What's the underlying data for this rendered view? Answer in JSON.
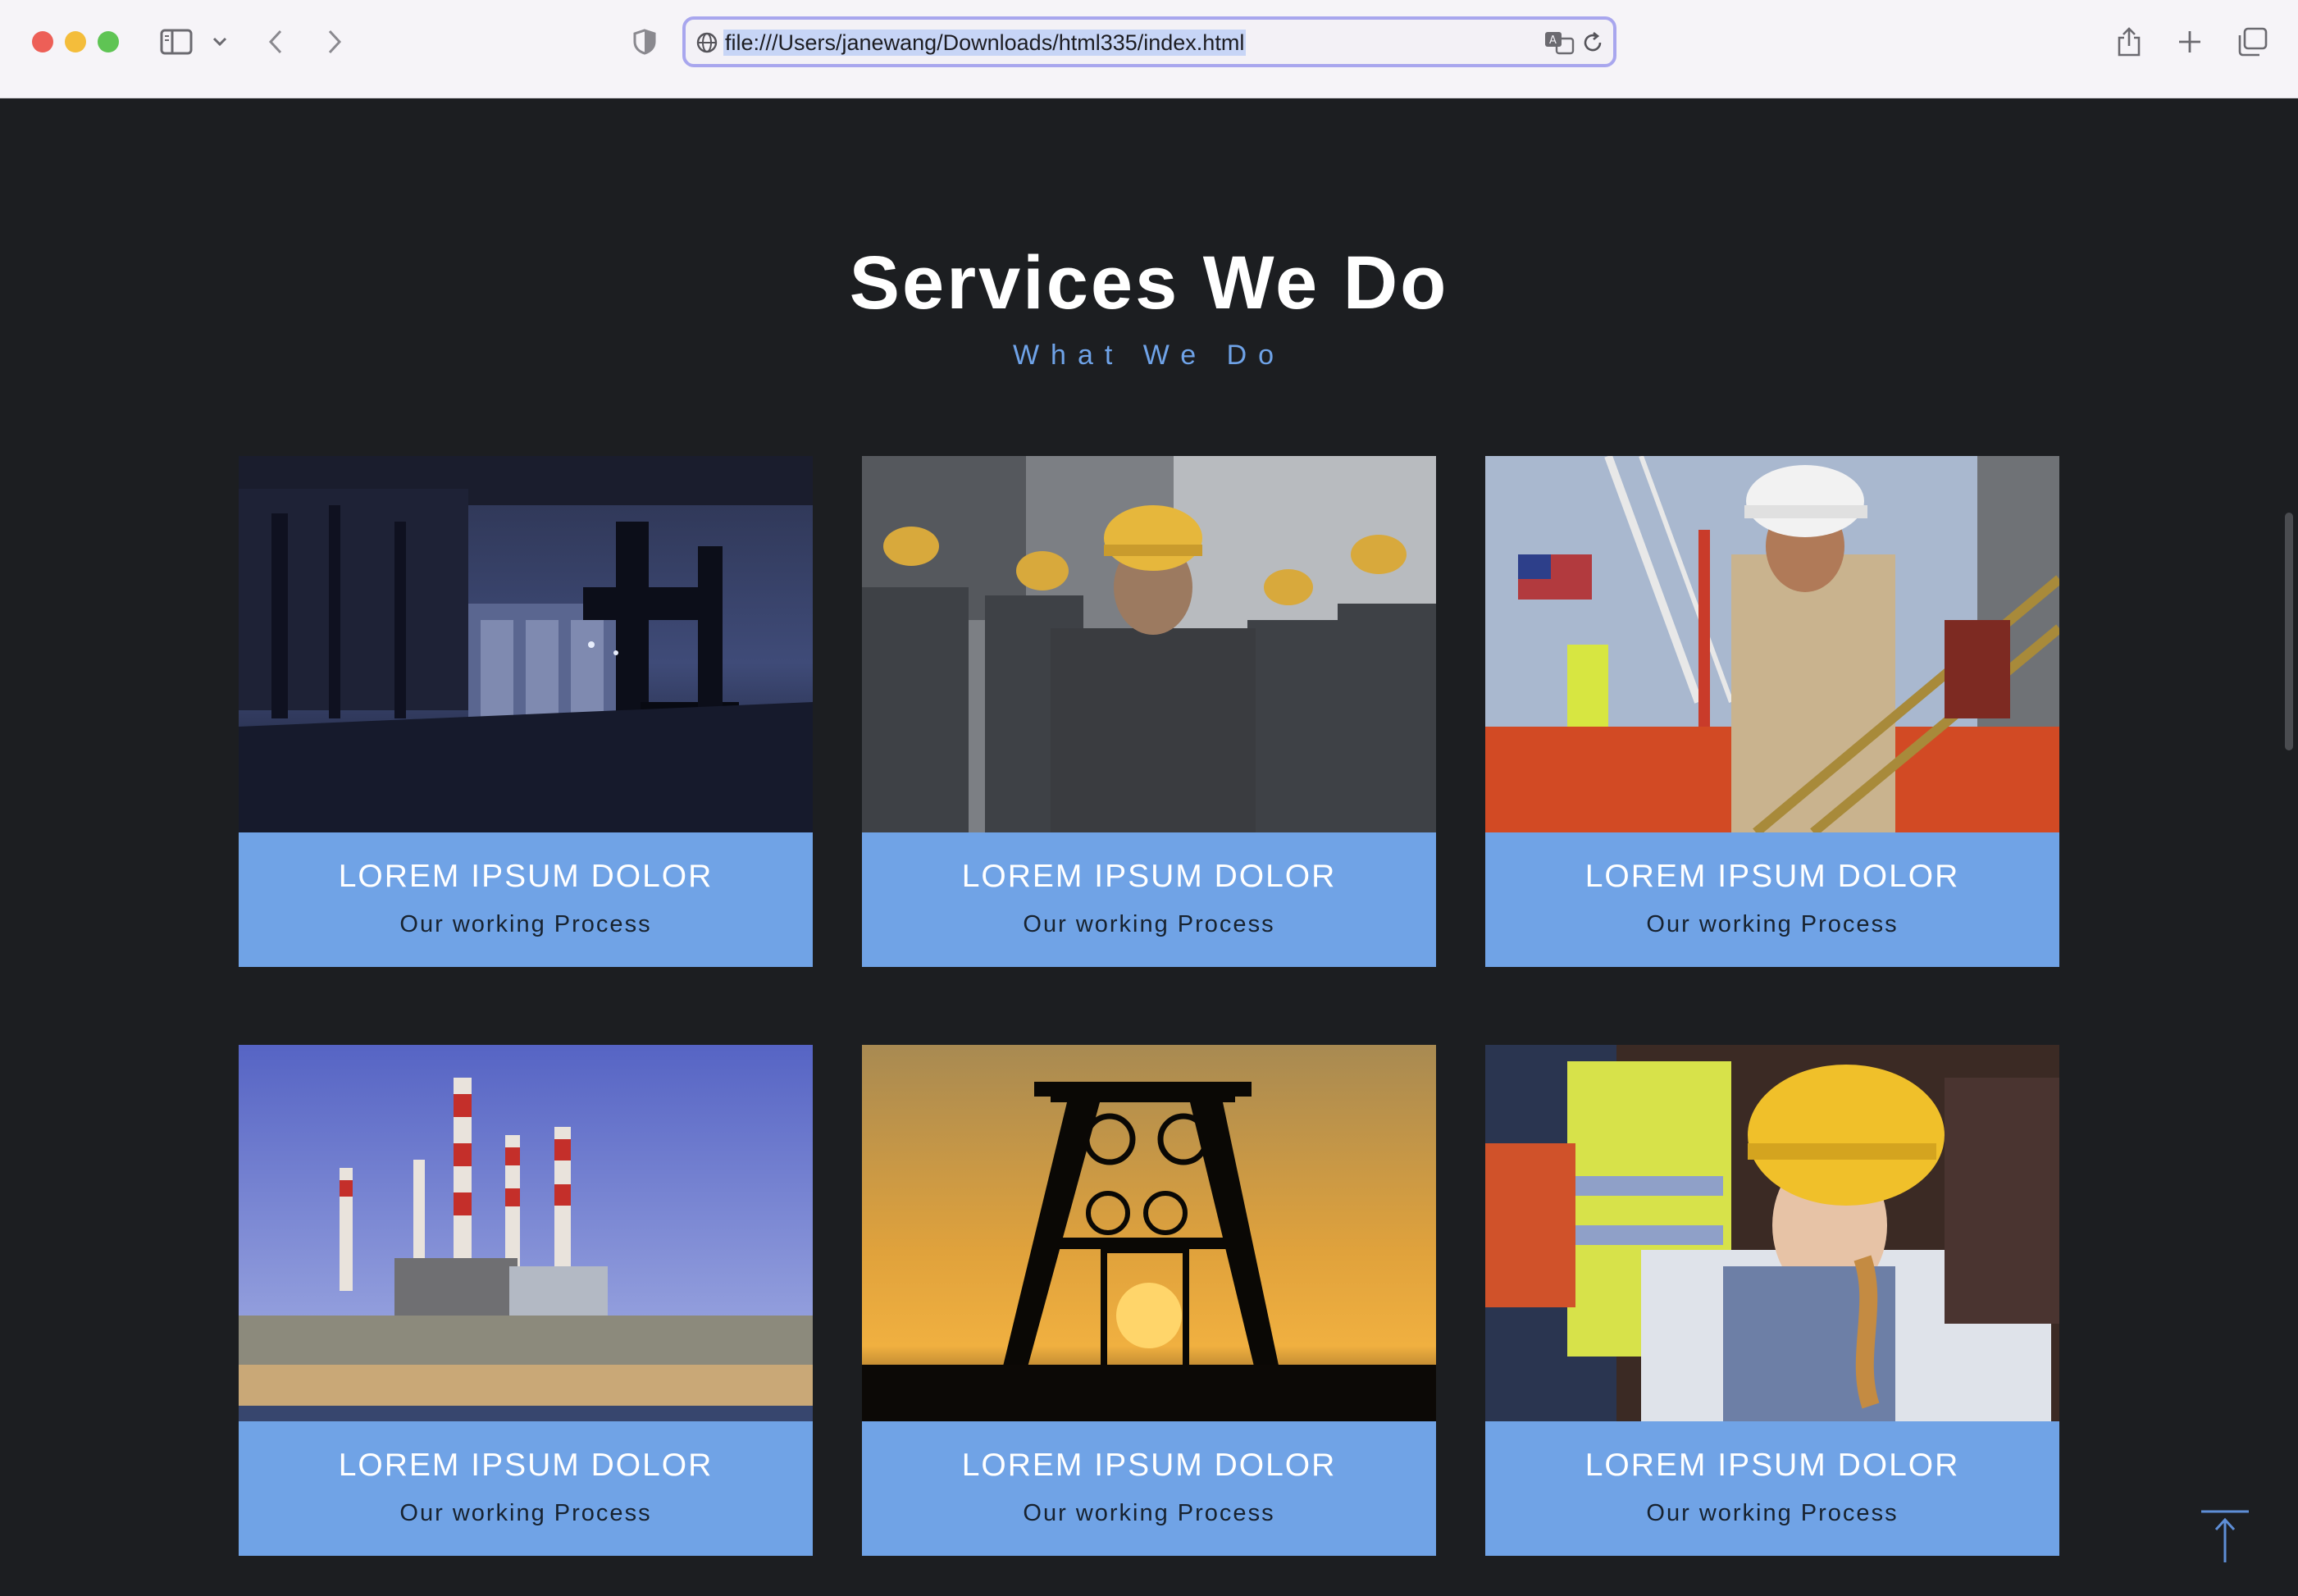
{
  "browser": {
    "url": "file:///Users/janewang/Downloads/html335/index.html",
    "icons": [
      "sidebar-icon",
      "chevron-down-icon",
      "back-icon",
      "forward-icon",
      "shield-icon",
      "globe-icon",
      "translate-icon",
      "reload-icon",
      "share-icon",
      "new-tab-icon",
      "tab-overview-icon"
    ]
  },
  "section": {
    "title": "Services We Do",
    "subtitle": "What We Do"
  },
  "cards": [
    {
      "title": "LOREM IPSUM DOLOR",
      "subtitle": "Our working Process",
      "image": "industrial-facility-night"
    },
    {
      "title": "LOREM IPSUM DOLOR",
      "subtitle": "Our working Process",
      "image": "workers-yellow-helmets"
    },
    {
      "title": "LOREM IPSUM DOLOR",
      "subtitle": "Our working Process",
      "image": "worker-chains-white-helmet"
    },
    {
      "title": "LOREM IPSUM DOLOR",
      "subtitle": "Our working Process",
      "image": "power-plant-smokestacks"
    },
    {
      "title": "LOREM IPSUM DOLOR",
      "subtitle": "Our working Process",
      "image": "mine-headframe-sunset"
    },
    {
      "title": "LOREM IPSUM DOLOR",
      "subtitle": "Our working Process",
      "image": "woman-engineer-phone"
    }
  ],
  "colors": {
    "background": "#1c1e21",
    "card_accent": "#70a3e6",
    "subtitle": "#6fa3e8"
  }
}
